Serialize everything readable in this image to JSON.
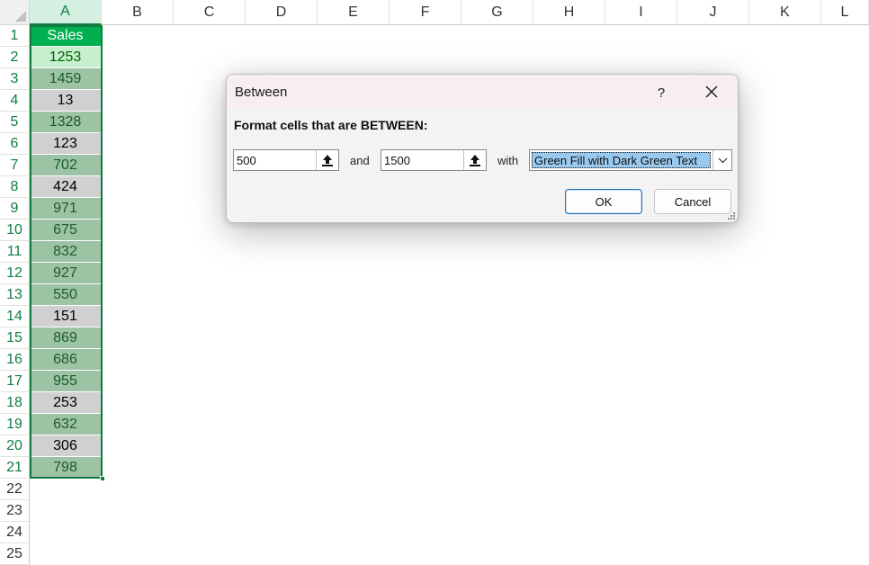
{
  "columns": [
    "A",
    "B",
    "C",
    "D",
    "E",
    "F",
    "G",
    "H",
    "I",
    "J",
    "K",
    "L"
  ],
  "rows": [
    "1",
    "2",
    "3",
    "4",
    "5",
    "6",
    "7",
    "8",
    "9",
    "10",
    "11",
    "12",
    "13",
    "14",
    "15",
    "16",
    "17",
    "18",
    "19",
    "20",
    "21",
    "22",
    "23",
    "24",
    "25"
  ],
  "column_a": {
    "header": "Sales",
    "values": [
      "1253",
      "1459",
      "13",
      "1328",
      "123",
      "702",
      "424",
      "971",
      "675",
      "832",
      "927",
      "550",
      "151",
      "869",
      "686",
      "955",
      "253",
      "632",
      "306",
      "798"
    ]
  },
  "colors": {
    "header_fill": "#00b050",
    "green_fill": "#c6efce",
    "dark_green_text": "#006100",
    "selection_border": "#107c41"
  },
  "dialog": {
    "title": "Between",
    "help_label": "?",
    "prompt": "Format cells that are BETWEEN:",
    "lower_value": "500",
    "and_label": "and",
    "upper_value": "1500",
    "with_label": "with",
    "format_selected": "Green Fill with Dark Green Text",
    "ok_label": "OK",
    "cancel_label": "Cancel"
  },
  "icons": {
    "close": "close-icon",
    "range_picker": "collapse-dialog-icon",
    "dropdown": "chevron-down-icon",
    "resize": "resize-grip-icon"
  }
}
